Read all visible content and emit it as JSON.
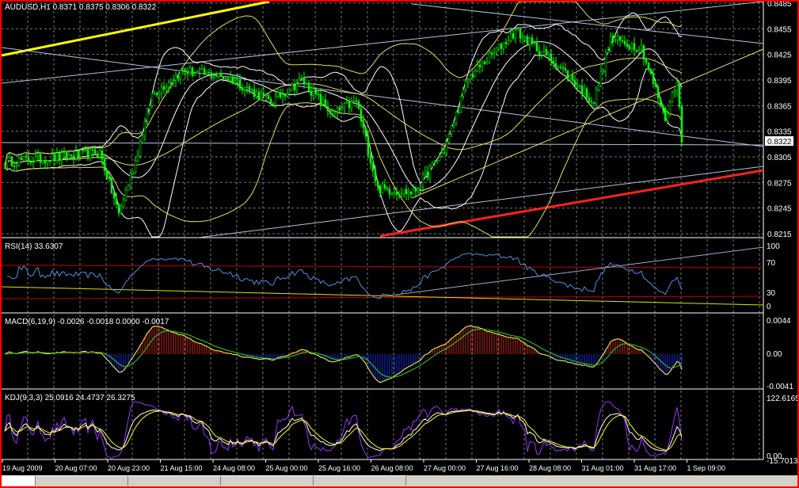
{
  "window": {
    "symbol_info": "AUDUSD,H1  0.8371 0.8375 0.8306 0.8322",
    "current_price": "0.8322"
  },
  "colors": {
    "bull": "#00ff00",
    "bear": "#00ff00",
    "support": "#ff2020",
    "resistance": "#ffff00",
    "rsi": "#4a90e2",
    "macd_pos": "#c0281c",
    "macd_neg": "#1a2ad0",
    "k": "#ffffff",
    "d": "#ffff00",
    "j": "#9933ff"
  },
  "price_axis": [
    "0.8485",
    "0.8455",
    "0.8425",
    "0.8395",
    "0.8365",
    "0.8335",
    "0.8305",
    "0.8275",
    "0.8245",
    "0.8215"
  ],
  "rsi": {
    "label": "RSI(14) 33.6307",
    "axis": [
      "100",
      "70",
      "30",
      "0"
    ]
  },
  "macd": {
    "label": "MACD(6,19,9) -0.0026 -0.0018 0.0000 -0.0017",
    "axis": [
      "0.0044",
      "0.00",
      "-0.0041"
    ]
  },
  "kdj": {
    "label": "KDJ(9,3,3) 25.0916 24.4737 26.3275",
    "axis": [
      "122.6165",
      "0.00",
      "-15.7013"
    ]
  },
  "time_axis": [
    "19 Aug 2009",
    "20 Aug 07:00",
    "20 Aug 23:00",
    "21 Aug 15:00",
    "24 Aug 08:00",
    "25 Aug 00:00",
    "25 Aug 16:00",
    "26 Aug 08:00",
    "27 Aug 00:00",
    "27 Aug 16:00",
    "28 Aug 08:00",
    "31 Aug 01:00",
    "31 Aug 17:00",
    "1 Sep 09:00"
  ],
  "chart_data": {
    "type": "candlestick",
    "title": "AUDUSD,H1",
    "ylim": [
      0.8215,
      0.8485
    ],
    "anchors": [
      [
        0,
        0.8299
      ],
      [
        25,
        0.8305
      ],
      [
        40,
        0.831
      ],
      [
        48,
        0.8238
      ],
      [
        55,
        0.83
      ],
      [
        62,
        0.8378
      ],
      [
        75,
        0.8406
      ],
      [
        95,
        0.8397
      ],
      [
        112,
        0.8369
      ],
      [
        125,
        0.8395
      ],
      [
        138,
        0.8355
      ],
      [
        148,
        0.837
      ],
      [
        157,
        0.8268
      ],
      [
        172,
        0.8263
      ],
      [
        185,
        0.8313
      ],
      [
        195,
        0.8397
      ],
      [
        215,
        0.8452
      ],
      [
        232,
        0.8415
      ],
      [
        248,
        0.8369
      ],
      [
        255,
        0.8443
      ],
      [
        268,
        0.8433
      ],
      [
        278,
        0.835
      ],
      [
        283,
        0.8397
      ],
      [
        285,
        0.8322
      ]
    ]
  }
}
